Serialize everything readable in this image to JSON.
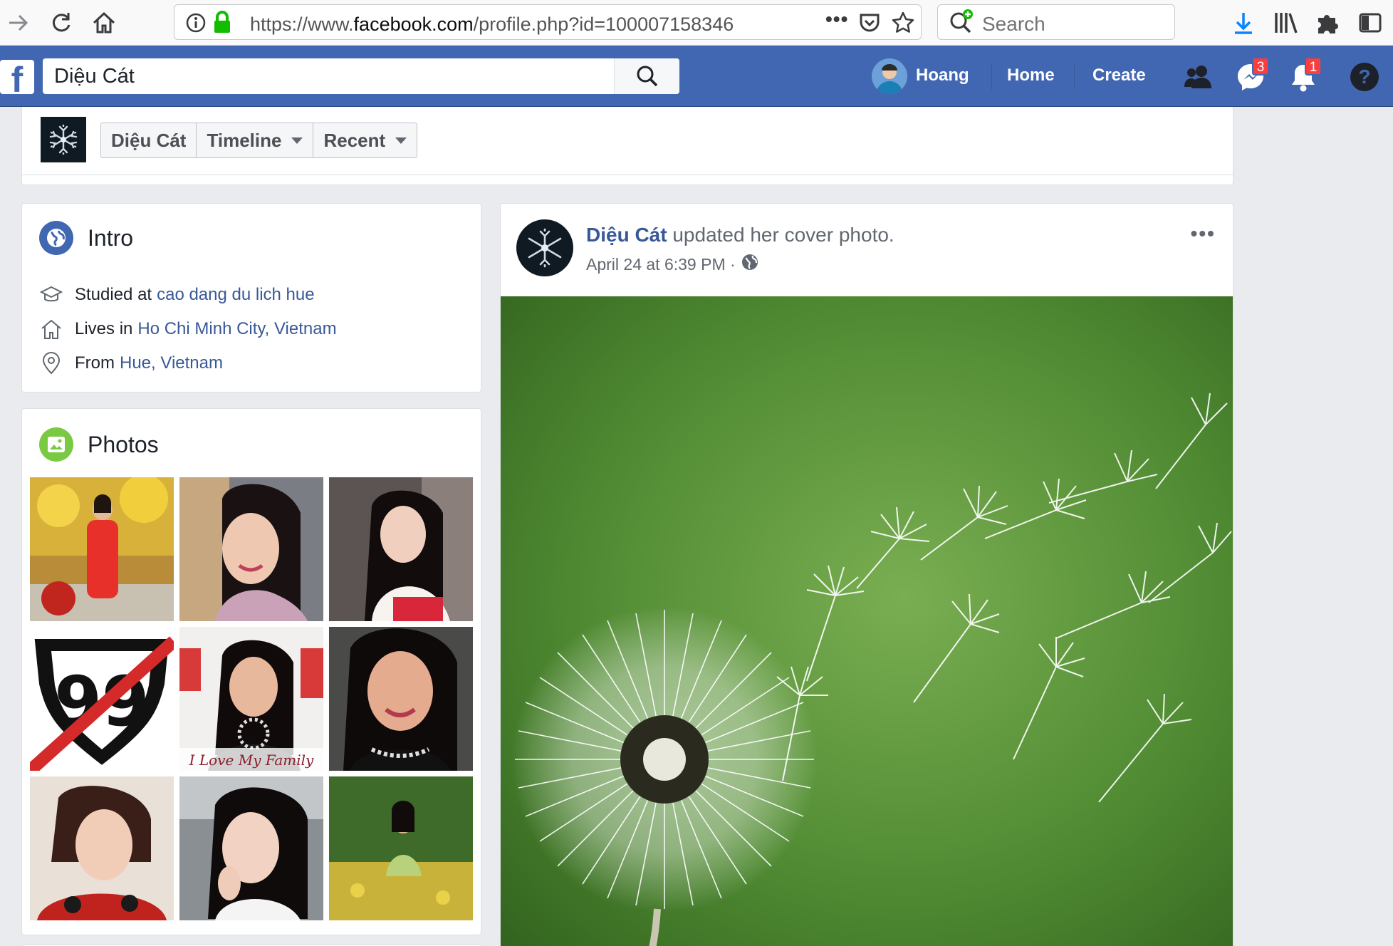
{
  "browser": {
    "url_prefix": "https://www.",
    "url_domain": "facebook.com",
    "url_path": "/profile.php?id=10000715834​6",
    "search_placeholder": "Search"
  },
  "fb": {
    "logo": "f",
    "search_value": "Diệu Cát",
    "user_name": "Hoang",
    "nav_home": "Home",
    "nav_create": "Create",
    "messages_count": "3",
    "notifications_count": "1",
    "help": "?"
  },
  "profile_nav": {
    "name": "Diệu Cát",
    "timeline": "Timeline",
    "recent": "Recent"
  },
  "intro": {
    "title": "Intro",
    "studied_prefix": "Studied at",
    "studied_link": "cao dang du lich hue",
    "lives_prefix": "Lives in",
    "lives_link": "Ho Chi Minh City, Vietnam",
    "from_prefix": "From",
    "from_link": "Hue, Vietnam"
  },
  "photos": {
    "title": "Photos",
    "items": [
      {
        "caption": ""
      },
      {
        "caption": ""
      },
      {
        "caption": ""
      },
      {
        "caption": "99"
      },
      {
        "caption": "I Love My Family"
      },
      {
        "caption": ""
      },
      {
        "caption": ""
      },
      {
        "caption": ""
      },
      {
        "caption": ""
      }
    ]
  },
  "post": {
    "author": "Diệu Cát",
    "action": "updated her cover photo.",
    "timestamp": "April 24 at 6:39 PM ·",
    "more": "•••"
  },
  "colors": {
    "fb_blue": "#4267b2",
    "link_blue": "#385898",
    "badge_red": "#fa3e3e"
  }
}
